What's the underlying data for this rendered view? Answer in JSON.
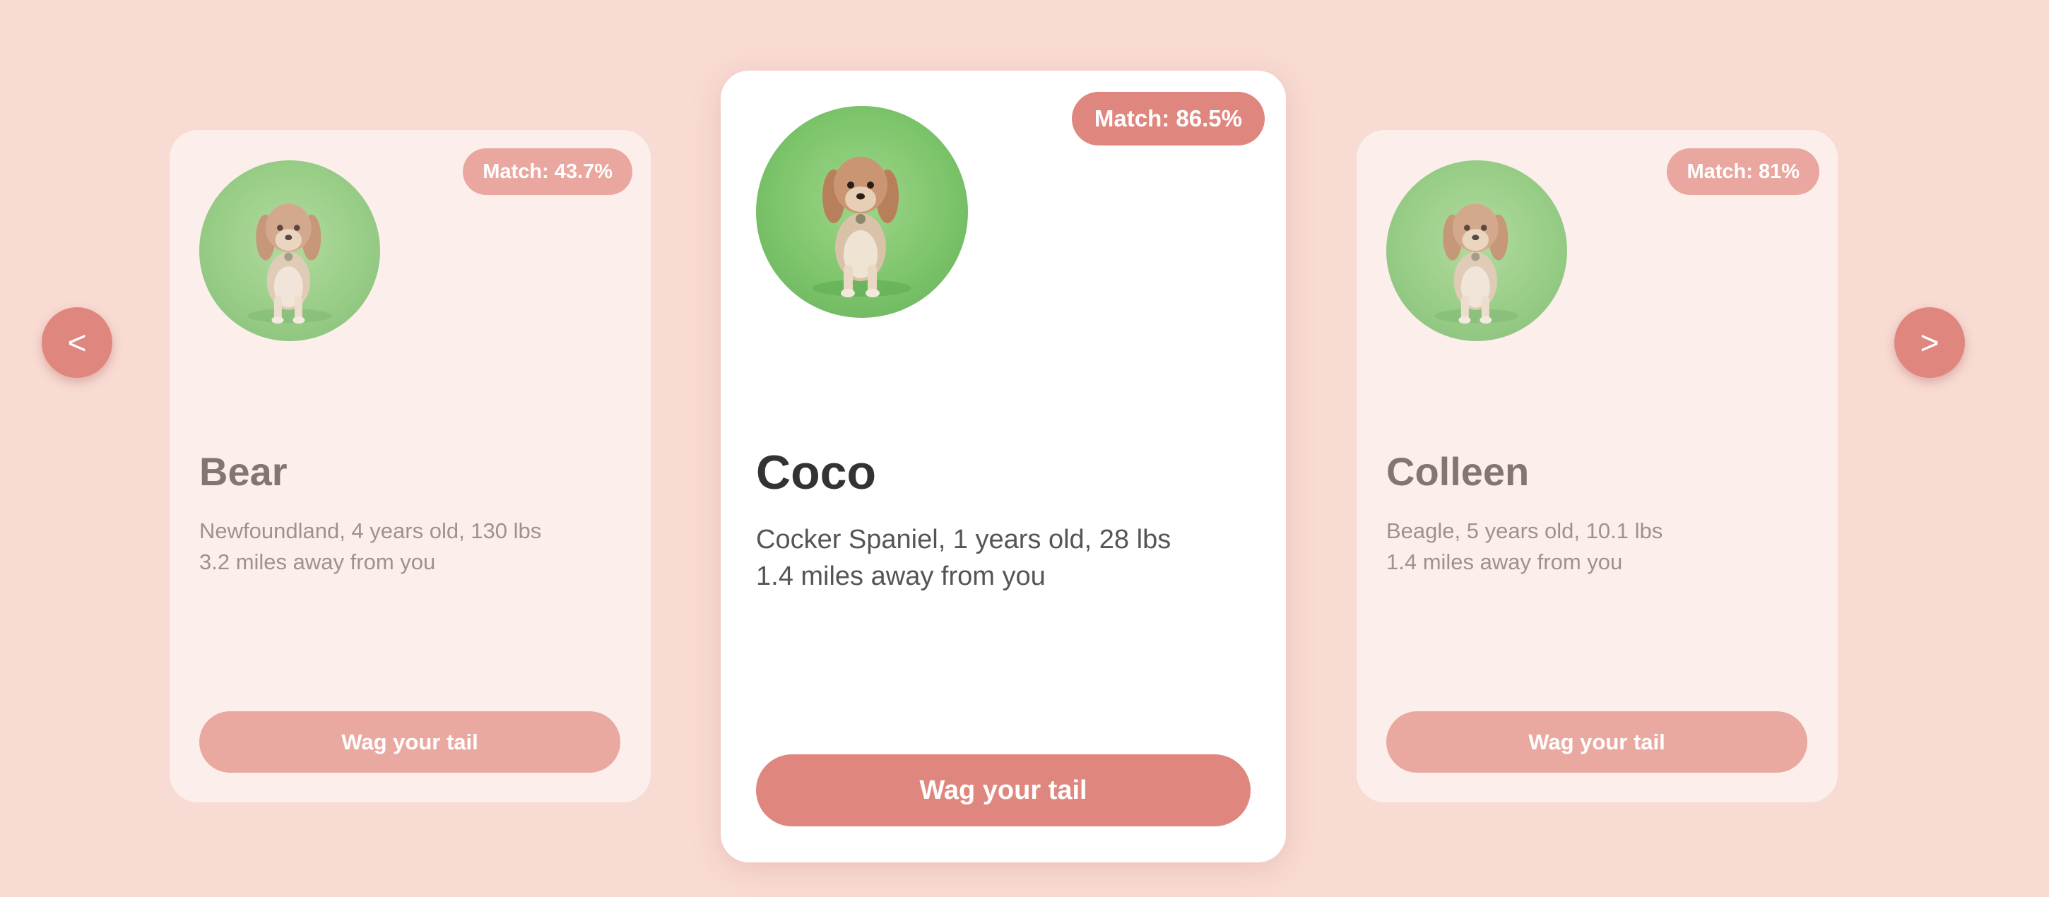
{
  "carousel": {
    "prev_label": "<",
    "next_label": ">"
  },
  "cards": [
    {
      "name": "Bear",
      "match": "Match: 43.7%",
      "details_line1": "Newfoundland, 4 years old, 130 lbs",
      "details_line2": "3.2 miles away from you",
      "button_label": "Wag your tail",
      "image": "dog-photo"
    },
    {
      "name": "Coco",
      "match": "Match: 86.5%",
      "details_line1": "Cocker Spaniel, 1 years old, 28 lbs",
      "details_line2": "1.4 miles away from you",
      "button_label": "Wag your tail",
      "image": "dog-photo"
    },
    {
      "name": "Colleen",
      "match": "Match: 81%",
      "details_line1": "Beagle, 5 years old, 10.1 lbs",
      "details_line2": "1.4 miles away from you",
      "button_label": "Wag your tail",
      "image": "dog-photo"
    }
  ],
  "colors": {
    "background": "#f8dbd3",
    "accent": "#df877f",
    "side_card_bg": "#fcefeb",
    "center_card_bg": "#ffffff"
  }
}
